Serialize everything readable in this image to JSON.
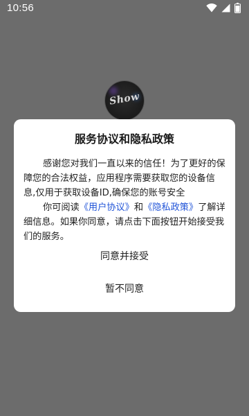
{
  "status_bar": {
    "time": "10:56",
    "icons": [
      "wifi-icon",
      "signal-icon",
      "battery-icon"
    ]
  },
  "app": {
    "logo_text": "Show"
  },
  "dialog": {
    "title": "服务协议和隐私政策",
    "paragraph1": "感谢您对我们一直以来的信任！为了更好的保障您的合法权益，应用程序需要获取您的设备信息,仅用于获取设备ID,确保您的账号安全",
    "paragraph2_prefix": "你可阅读",
    "user_agreement_link": "《用户协议》",
    "and_text": "和",
    "privacy_policy_link": "《隐私政策》",
    "paragraph2_suffix": "了解详细信息。如果你同意，请点击下面按钮开始接受我们的服务。",
    "agree_label": "同意并接受",
    "disagree_label": "暂不同意"
  },
  "colors": {
    "overlay_background": "#6c6c6c",
    "dialog_background": "#ffffff",
    "link": "#2255d8",
    "text": "#222222"
  }
}
